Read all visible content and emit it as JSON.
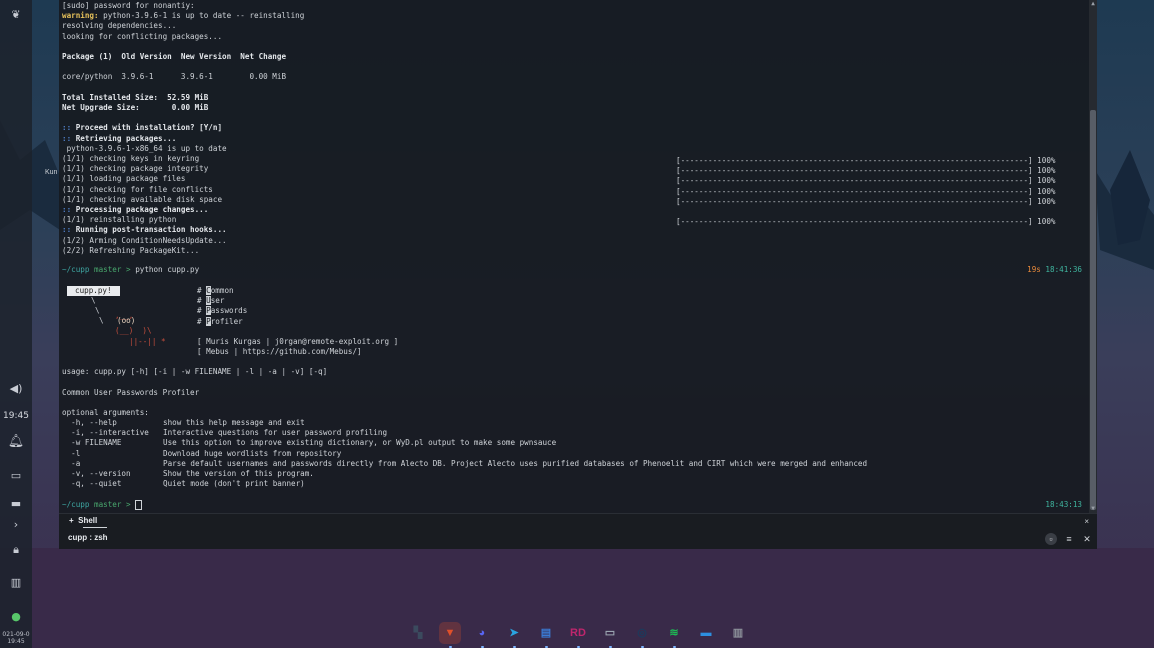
{
  "desktop": {
    "left_panel": {
      "clock": "19:45",
      "date_line1": "021-09-0",
      "date_line2": "19:45",
      "desktop_label": "Kun",
      "icons": [
        "bat-icon",
        "volume-icon",
        "bell-icon",
        "device-icon",
        "archive-icon",
        "chevron-right-icon",
        "lock-icon",
        "trash-icon",
        "update-check-icon"
      ]
    }
  },
  "terminal": {
    "lines": [
      {
        "text": "[sudo] password for nonantiy:"
      },
      {
        "prefix": "warning:",
        "text": " python-3.9.6-1 is up to date -- reinstalling"
      },
      {
        "text": "resolving dependencies..."
      },
      {
        "text": "looking for conflicting packages..."
      },
      {
        "text": ""
      },
      {
        "text": "Package (1)  Old Version  New Version  Net Change",
        "bold": true
      },
      {
        "text": ""
      },
      {
        "text": "core/python  3.9.6-1      3.9.6-1        0.00 MiB"
      },
      {
        "text": ""
      },
      {
        "text": "Total Installed Size:  52.59 MiB",
        "bold": true
      },
      {
        "text": "Net Upgrade Size:       0.00 MiB",
        "bold": true
      },
      {
        "text": ""
      },
      {
        "prefix_blue": "::",
        "text": " Proceed with installation? [Y/n]",
        "bold": true
      },
      {
        "prefix_blue": "::",
        "text": " Retrieving packages...",
        "bold": true
      },
      {
        "text": " python-3.9.6-1-x86_64 is up to date"
      },
      {
        "text": "(1/1) checking keys in keyring"
      },
      {
        "text": "(1/1) checking package integrity"
      },
      {
        "text": "(1/1) loading package files"
      },
      {
        "text": "(1/1) checking for file conflicts"
      },
      {
        "text": "(1/1) checking available disk space"
      },
      {
        "prefix_blue": "::",
        "text": " Processing package changes...",
        "bold": true
      },
      {
        "text": "(1/1) reinstalling python"
      },
      {
        "prefix_blue": "::",
        "text": " Running post-transaction hooks...",
        "bold": true
      },
      {
        "text": "(1/2) Arming ConditionNeedsUpdate..."
      },
      {
        "text": "(2/2) Refreshing PackageKit..."
      }
    ],
    "progress_bars": [
      {
        "bar": "[----------------------------------------------------------------------------] 100%",
        "row": 15
      },
      {
        "bar": "[----------------------------------------------------------------------------] 100%",
        "row": 16
      },
      {
        "bar": "[----------------------------------------------------------------------------] 100%",
        "row": 17
      },
      {
        "bar": "[----------------------------------------------------------------------------] 100%",
        "row": 18
      },
      {
        "bar": "[----------------------------------------------------------------------------] 100%",
        "row": 19
      },
      {
        "bar": "[----------------------------------------------------------------------------] 100%",
        "row": 21
      }
    ],
    "prompt1": {
      "dir": "~/cupp",
      "branch": "master",
      "arrow": ">",
      "command": "python cupp.py",
      "duration": "19s",
      "time": "18:41:36"
    },
    "banner": {
      "bubble": "cupp.py!",
      "hash_lines": [
        {
          "hash": "#",
          "first": "C",
          "rest": "ommon"
        },
        {
          "hash": "#",
          "first": "U",
          "rest": "ser"
        },
        {
          "hash": "#",
          "first": "P",
          "rest": "asswords"
        },
        {
          "hash": "#",
          "first": "P",
          "rest": "rofiler"
        }
      ],
      "art_backslash1": "\\",
      "art_backslash2": "\\",
      "art_line3": "\\",
      "art_eyes": "(oo)",
      "art_body1": ",__,",
      "art_body2": "(__)  )\\",
      "art_legs": "||--|| *",
      "credits": [
        "[ Muris Kurgas | j0rgan@remote-exploit.org ]",
        "[ Mebus | https://github.com/Mebus/]"
      ]
    },
    "usage": "usage: cupp.py [-h] [-i | -w FILENAME | -l | -a | -v] [-q]",
    "description": "Common User Passwords Profiler",
    "optional_header": "optional arguments:",
    "options": [
      {
        "flag": "  -h, --help",
        "desc": "show this help message and exit"
      },
      {
        "flag": "  -i, --interactive",
        "desc": "Interactive questions for user password profiling"
      },
      {
        "flag": "  -w FILENAME",
        "desc": "Use this option to improve existing dictionary, or WyD.pl output to make some pwnsauce"
      },
      {
        "flag": "  -l",
        "desc": "Download huge wordlists from repository"
      },
      {
        "flag": "  -a",
        "desc": "Parse default usernames and passwords directly from Alecto DB. Project Alecto uses purified databases of Phenoelit and CIRT which were merged and enhanced"
      },
      {
        "flag": "  -v, --version",
        "desc": "Show the version of this program."
      },
      {
        "flag": "  -q, --quiet",
        "desc": "Quiet mode (don't print banner)"
      }
    ],
    "prompt2": {
      "dir": "~/cupp",
      "branch": "master",
      "arrow": ">",
      "time": "18:43:13"
    }
  },
  "tabbar": {
    "tab_label": "Shell",
    "tab_marker": "+",
    "close_symbol": "×",
    "session_label": "cupp : zsh",
    "controls": [
      "restore-icon",
      "menu-icon",
      "close-icon"
    ]
  },
  "dock": {
    "items": [
      {
        "name": "overview-icon",
        "glyph": "▚",
        "color": "#3b4a5e"
      },
      {
        "name": "brave-icon",
        "glyph": "▼",
        "color": "#e0502a",
        "active": true
      },
      {
        "name": "discord-icon",
        "glyph": "◕",
        "color": "#5865f2"
      },
      {
        "name": "telegram-icon",
        "glyph": "➤",
        "color": "#2aa3e0"
      },
      {
        "name": "notes-icon",
        "glyph": "▤",
        "color": "#3a7bd5"
      },
      {
        "name": "rider-icon",
        "glyph": "RD",
        "color": "#c0266d"
      },
      {
        "name": "files-icon",
        "glyph": "▭",
        "color": "#9aa4b0"
      },
      {
        "name": "steam-icon",
        "glyph": "◎",
        "color": "#1b3a5c"
      },
      {
        "name": "spotify-icon",
        "glyph": "≋",
        "color": "#1db954"
      },
      {
        "name": "folder-icon",
        "glyph": "▬",
        "color": "#2d8fe0"
      },
      {
        "name": "trash-dock-icon",
        "glyph": "▥",
        "color": "#8b9099"
      }
    ]
  }
}
